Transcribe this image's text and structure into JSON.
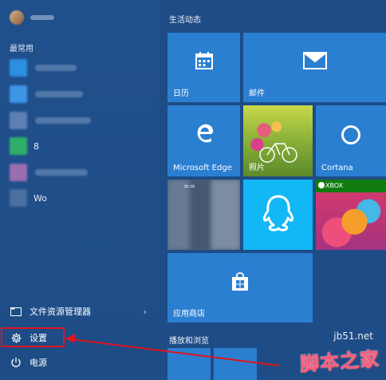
{
  "left": {
    "section_frequent": "最常用",
    "apps": [
      {
        "icon_color": "#2d8fe0",
        "text_width": 52,
        "label": ""
      },
      {
        "icon_color": "#3f95e6",
        "text_width": 60,
        "label": ""
      },
      {
        "icon_color": "#5d7fb3",
        "text_width": 70,
        "label": ""
      },
      {
        "icon_color": "#2fae6a",
        "text_width": 0,
        "label": "8"
      },
      {
        "icon_color": "#9a6fb0",
        "text_width": 66,
        "label": ""
      },
      {
        "icon_color": "#4b6f9e",
        "text_width": 0,
        "label": "Wo"
      }
    ],
    "bottom": {
      "file_explorer": "文件资源管理器",
      "settings": "设置",
      "power": "电源"
    }
  },
  "tiles": {
    "group_life": "生活动态",
    "group_play": "播放和浏览",
    "calendar": "日历",
    "mail": "邮件",
    "edge": "Microsoft Edge",
    "photos": "照片",
    "cortana": "Cortana",
    "store": "应用商店",
    "xbox": "XBOX",
    "blurred_prefix": "=="
  },
  "watermark": {
    "url": "jb51.net",
    "text": "脚本之家"
  },
  "colors": {
    "highlight": "#e0141c",
    "tile": "#2b7fd1"
  }
}
